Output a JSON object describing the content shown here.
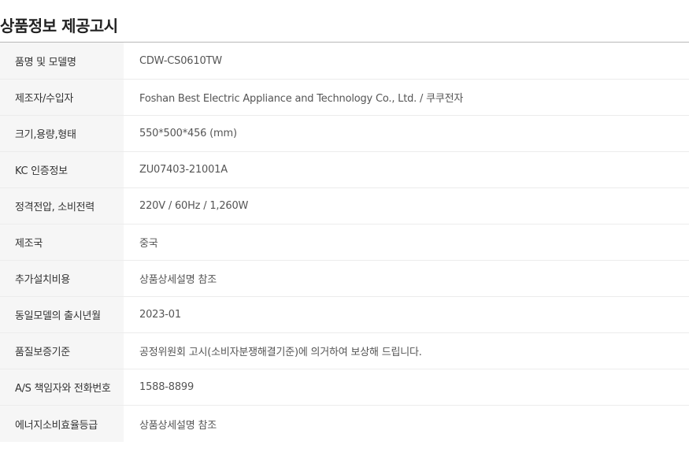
{
  "page_title": "상품정보 제공고시",
  "rows": [
    {
      "label": "품명 및 모델명",
      "value": "CDW-CS0610TW"
    },
    {
      "label": "제조자/수입자",
      "value": "Foshan Best Electric Appliance and Technology Co., Ltd. / 쿠쿠전자"
    },
    {
      "label": "크기,용량,형태",
      "value": "550*500*456 (mm)"
    },
    {
      "label": "KC 인증정보",
      "value": "ZU07403-21001A"
    },
    {
      "label": "정격전압, 소비전력",
      "value": "220V / 60Hz / 1,260W"
    },
    {
      "label": "제조국",
      "value": "중국"
    },
    {
      "label": "추가설치비용",
      "value": "상품상세설명 참조"
    },
    {
      "label": "동일모델의 출시년월",
      "value": "2023-01"
    },
    {
      "label": "품질보증기준",
      "value": "공정위원회 고시(소비자분쟁해결기준)에 의거하여 보상해 드립니다."
    },
    {
      "label": "A/S 책임자와 전화번호",
      "value": "1588-8899"
    },
    {
      "label": "에너지소비효율등급",
      "value": "상품상세설명 참조"
    }
  ]
}
